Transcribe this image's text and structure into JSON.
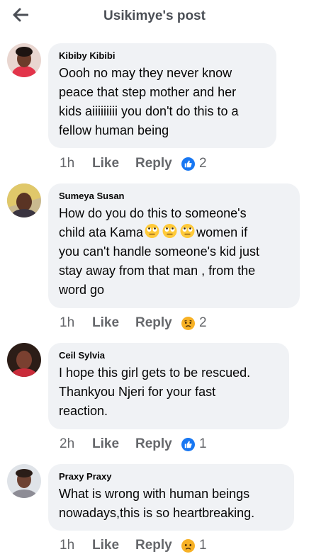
{
  "header": {
    "title": "Usikimye's post",
    "back_icon": "arrow-left-icon"
  },
  "comments": [
    {
      "author": "Kibiby Kibibi",
      "text": "Oooh no may they never know\npeace that step mother and her\nkids aiiiiiiiii you don't do this to a\nfellow human being",
      "time": "1h",
      "like": "Like",
      "reply": "Reply",
      "reaction": "like",
      "count": "2"
    },
    {
      "author": "Sumeya Susan",
      "text_pre": "How do you do this to someone's\nchild ata Kama",
      "text_post": "women if\nyou can't handle someone's kid just\nstay away from that man , from the\nword go",
      "time": "1h",
      "like": "Like",
      "reply": "Reply",
      "reaction": "sad",
      "count": "2"
    },
    {
      "author": "Ceil Sylvia",
      "text": "I hope this girl gets to be rescued.\nThankyou Njeri for your fast\nreaction.",
      "time": "2h",
      "like": "Like",
      "reply": "Reply",
      "reaction": "like",
      "count": "1"
    },
    {
      "author": "Praxy Praxy",
      "text": "What is wrong with human beings\nnowadays,this is so heartbreaking.",
      "time": "1h",
      "like": "Like",
      "reply": "Reply",
      "reaction": "sad",
      "count": "1"
    }
  ],
  "colors": {
    "bubble": "#f0f2f5",
    "like_blue": "#1877f2",
    "meta": "#65676b"
  }
}
